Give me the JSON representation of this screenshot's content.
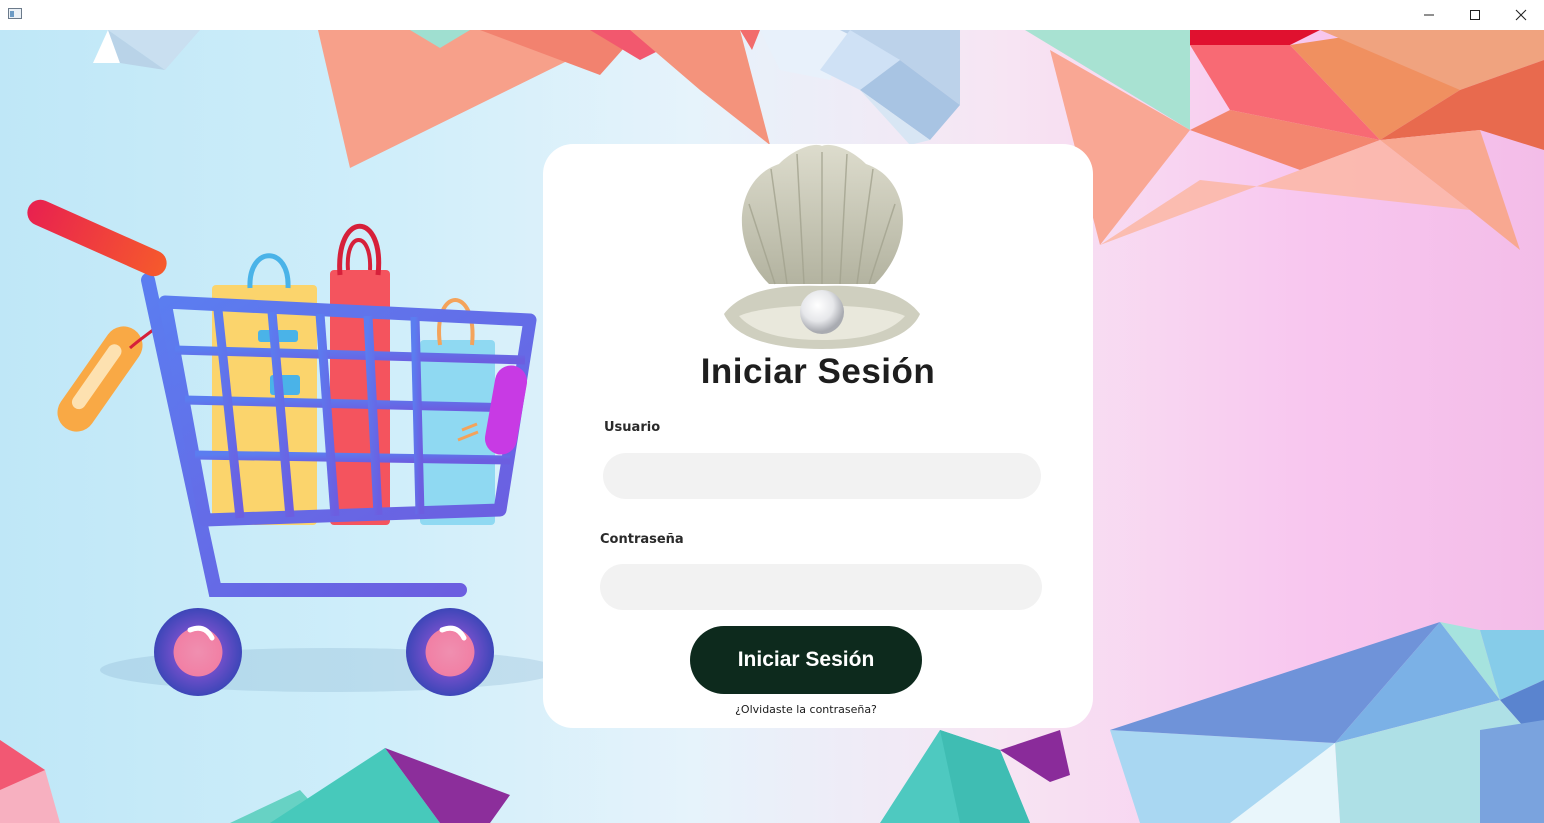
{
  "window": {
    "minimize_icon": "minimize-icon",
    "maximize_icon": "maximize-icon",
    "close_icon": "close-icon"
  },
  "login": {
    "title": "Iniciar Sesión",
    "username_label": "Usuario",
    "username_value": "",
    "password_label": "Contraseña",
    "password_value": "",
    "submit_label": "Iniciar Sesión",
    "forgot_link": "¿Olvidaste la contraseña?",
    "logo_icon": "pearl-shell-icon"
  },
  "illustration": {
    "icon": "shopping-cart-icon"
  },
  "colors": {
    "button_bg": "#0d2a1d",
    "input_bg": "#f2f2f2",
    "card_bg": "#ffffff"
  }
}
